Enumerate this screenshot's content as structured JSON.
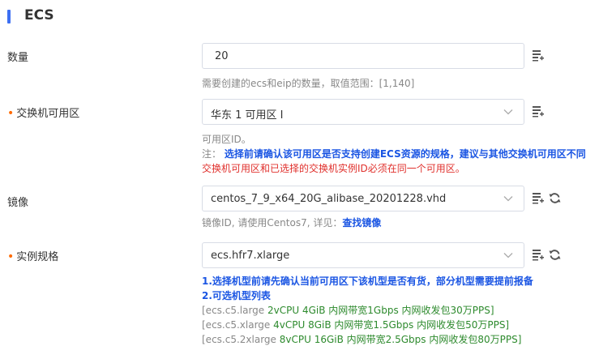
{
  "section": {
    "title": "ECS"
  },
  "count": {
    "label": "数量",
    "value": "20",
    "hint": "需要创建的ecs和eip的数量，取值范围：[1,140]"
  },
  "zone": {
    "label": "交换机可用区",
    "value": "华东 1 可用区 I",
    "hint": "可用区ID。",
    "note_prefix": "注：",
    "note_blue": "选择前请确认该可用区是否支持创建ECS资源的规格，建议与其他交换机可用区不同",
    "note_red": "交换机可用区和已选择的交换机实例ID必须在同一个可用区。"
  },
  "image": {
    "label": "镜像",
    "value": "centos_7_9_x64_20G_alibase_20201228.vhd",
    "hint": "镜像ID, 请使用Centos7, 详见：",
    "link": "查找镜像"
  },
  "spec": {
    "label": "实例规格",
    "value": "ecs.hfr7.xlarge",
    "note1": "1.选择机型前请先确认当前可用区下该机型是否有货，部分机型需要提前报备",
    "note2": "2.可选机型列表",
    "models": [
      {
        "name": "[ecs.c5.large",
        "desc": "2vCPU 4GiB 内网带宽1Gbps 内网收发包30万PPS]"
      },
      {
        "name": "[ecs.c5.xlarge",
        "desc": "4vCPU 8GiB 内网带宽1.5Gbps 内网收发包50万PPS]"
      },
      {
        "name": "[ecs.c5.2xlarge",
        "desc": "8vCPU 16GiB 内网带宽2.5Gbps 内网收发包80万PPS]"
      }
    ]
  },
  "colors": {
    "accent": "#3d6ff2",
    "required": "#ff6a00",
    "note_blue": "#1a55e3",
    "note_red": "#e0302c",
    "model_green": "#2d8a2d"
  }
}
